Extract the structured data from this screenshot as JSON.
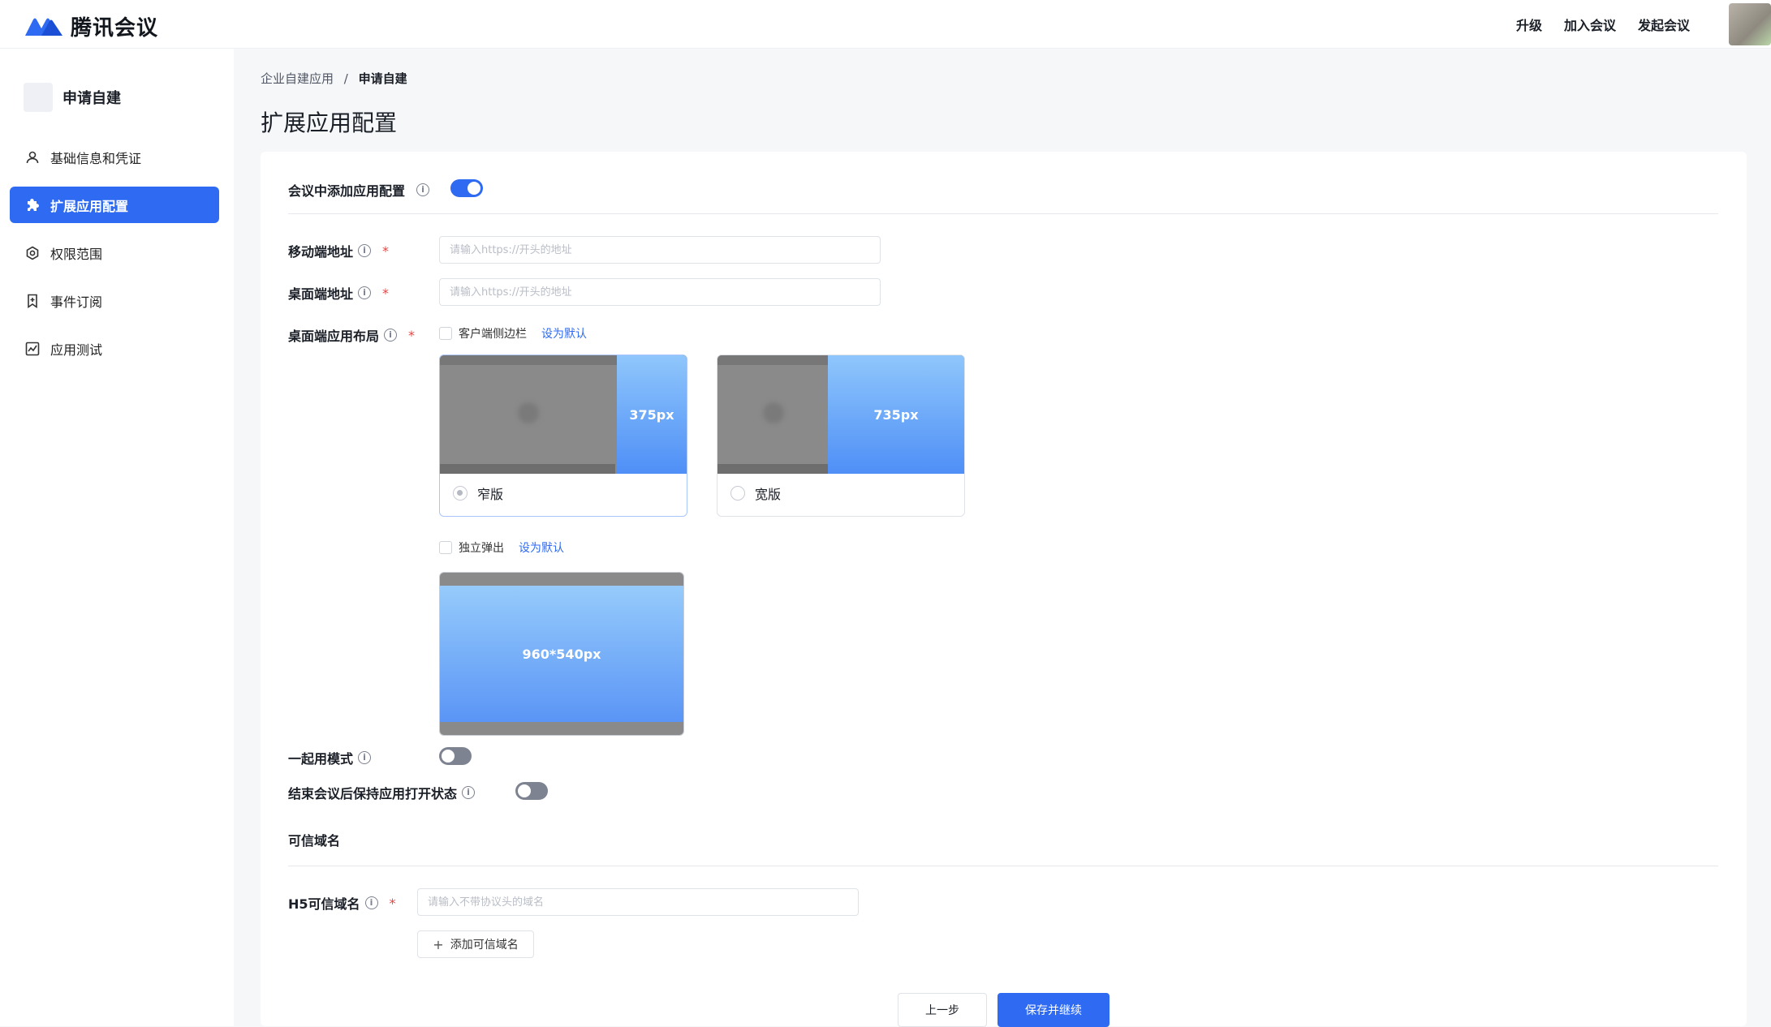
{
  "app": {
    "name": "腾讯会议"
  },
  "header": {
    "actions": [
      "升级",
      "加入会议",
      "发起会议"
    ]
  },
  "sidebar": {
    "app_name": "申请自建",
    "items": [
      {
        "label": "基础信息和凭证",
        "icon": "user-icon",
        "active": false
      },
      {
        "label": "扩展应用配置",
        "icon": "puzzle-icon",
        "active": true
      },
      {
        "label": "权限范围",
        "icon": "shield-gear-icon",
        "active": false
      },
      {
        "label": "事件订阅",
        "icon": "bookmark-icon",
        "active": false
      },
      {
        "label": "应用测试",
        "icon": "chart-icon",
        "active": false
      }
    ]
  },
  "breadcrumb": {
    "parent": "企业自建应用",
    "separator": "/",
    "current": "申请自建"
  },
  "page_title": "扩展应用配置",
  "form": {
    "in_meeting_config": {
      "label": "会议中添加应用配置",
      "enabled": true
    },
    "mobile_url": {
      "label": "移动端地址",
      "placeholder": "请输入https://开头的地址",
      "value": ""
    },
    "desktop_url": {
      "label": "桌面端地址",
      "placeholder": "请输入https://开头的地址",
      "value": ""
    },
    "desktop_layout": {
      "label": "桌面端应用布局",
      "sidebar_option": {
        "label": "客户端侧边栏",
        "checked": false,
        "default_link": "设为默认"
      },
      "narrow": {
        "width_label": "375px",
        "label": "窄版",
        "selected": true
      },
      "wide": {
        "width_label": "735px",
        "label": "宽版",
        "selected": false
      },
      "popup_option": {
        "label": "独立弹出",
        "checked": false,
        "default_link": "设为默认"
      },
      "popup_size_label": "960*540px"
    },
    "together_mode": {
      "label": "一起用模式",
      "enabled": false
    },
    "keep_open": {
      "label": "结束会议后保持应用打开状态",
      "enabled": false
    },
    "trusted_domain_section": "可信域名",
    "h5_domain": {
      "label": "H5可信域名",
      "placeholder": "请输入不带协议头的域名",
      "value": ""
    },
    "add_domain_button": "添加可信域名"
  },
  "footer": {
    "prev_button": "上一步",
    "save_button": "保存并继续"
  },
  "colors": {
    "primary": "#2f6bf2",
    "required": "#e54545"
  }
}
